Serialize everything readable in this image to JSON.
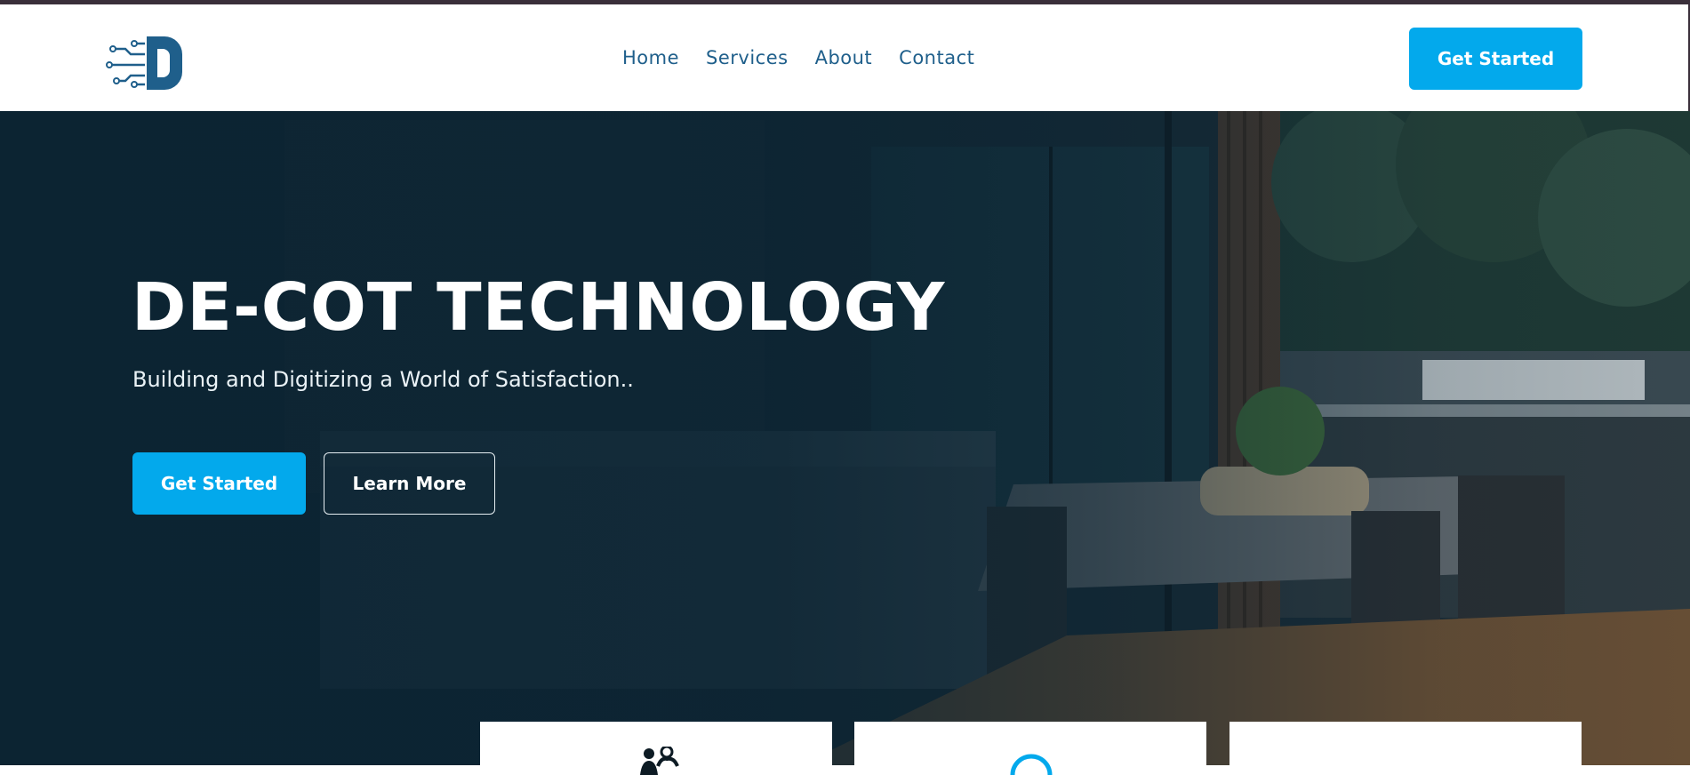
{
  "header": {
    "logo_icon": "circuit-d-logo",
    "nav": [
      "Home",
      "Services",
      "About",
      "Contact"
    ],
    "cta_label": "Get Started"
  },
  "hero": {
    "title": "DE-COT TECHNOLOGY",
    "subtitle": "Building and Digitizing a World of Satisfaction..",
    "primary_label": "Get Started",
    "secondary_label": "Learn More"
  },
  "features": [
    {
      "icon": "team-icon"
    },
    {
      "icon": "circle-icon"
    },
    {
      "icon": ""
    }
  ],
  "colors": {
    "accent": "#03a9ec",
    "nav_text": "#1f5f8b",
    "overlay": "#0a2332"
  }
}
